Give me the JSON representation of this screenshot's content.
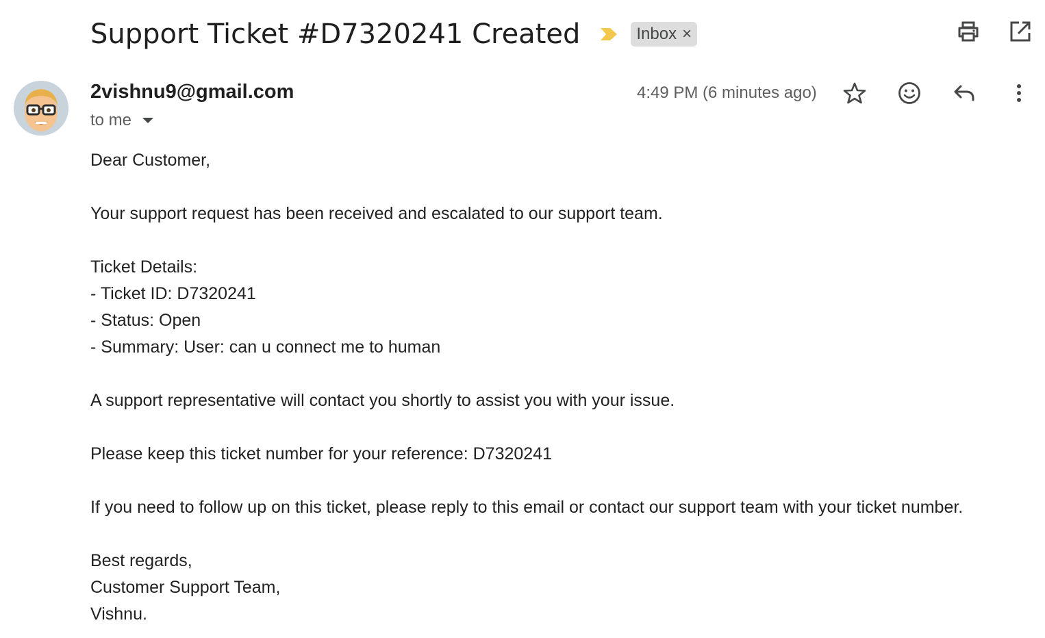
{
  "header": {
    "subject": "Support Ticket #D7320241 Created",
    "importance_icon": "importance-marker-icon",
    "label": "Inbox",
    "label_remove": "×",
    "actions": [
      "print-icon",
      "open-in-new-window-icon"
    ]
  },
  "message": {
    "sender": "2vishnu9@gmail.com",
    "recipient": "to me",
    "timestamp": "4:49 PM (6 minutes ago)",
    "actions": [
      "star-icon",
      "emoji-reaction-icon",
      "reply-icon",
      "more-options-icon"
    ]
  },
  "body": {
    "greeting": "Dear Customer,",
    "intro": "Your support request has been received and escalated to our support team.",
    "details_heading": "Ticket Details:",
    "details": [
      "- Ticket ID: D7320241",
      "- Status: Open",
      "- Summary: User: can u connect me to human"
    ],
    "contact_note": "A support representative will contact you shortly to assist you with your issue.",
    "reference_note": "Please keep this ticket number for your reference: D7320241",
    "follow_up": "If you need to follow up on this ticket, please reply to this email or contact our support team with your ticket number.",
    "sign_off": "Best regards,",
    "team": "Customer Support Team,",
    "name": "Vishnu."
  },
  "colors": {
    "importance": "#f2c94c",
    "label_bg": "#dddddd",
    "icon": "#444746",
    "text": "#1f1f1f",
    "muted": "#5e5e5e"
  }
}
